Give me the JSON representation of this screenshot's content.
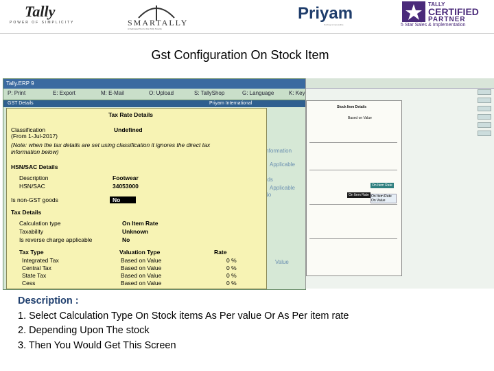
{
  "logos": {
    "tally": {
      "word": "Tally",
      "tagline": "POWER OF SIMPLICITY"
    },
    "smartally": {
      "word": "SMARTALLY",
      "tagline": "A Dedicated Tool to Run Tally Smartly"
    },
    "priyam": {
      "word": "Priyam",
      "tagline": "Nothing is Impossible"
    },
    "certified": {
      "line1": "TALLY",
      "line2": "CERTIFIED",
      "line3": "PARTNER",
      "line4": "5 Star Sales & Implementation"
    }
  },
  "slide_title": "Gst  Configuration On Stock Item",
  "tally_window": {
    "title": "Tally.ERP 9",
    "menu": [
      "P: Print",
      "E: Export",
      "M: E-Mail",
      "O: Upload",
      "S: TallyShop",
      "G: Language",
      "K: Keyboard"
    ],
    "header_left": "GST Details",
    "header_right": "Priyam International"
  },
  "gst_form": {
    "section_title": "Tax Rate Details",
    "classification_label": "Classification",
    "classification_sub": "(From 1-Jul-2017)",
    "classification_value": "Undefined",
    "note": "(Note: when the tax details are set using classification it ignores the direct tax information below)",
    "hsn_section": "HSN/SAC Details",
    "description_label": "Description",
    "description_value": "Footwear",
    "hsn_label": "HSN/SAC",
    "hsn_value": "34053000",
    "non_gst_label": "Is non-GST goods",
    "non_gst_value": "No",
    "tax_details": "Tax Details",
    "calc_type_label": "Calculation type",
    "calc_type_value": "On Item Rate",
    "taxability_label": "Taxability",
    "taxability_value": "Unknown",
    "reverse_label": "Is reverse charge applicable",
    "reverse_value": "No",
    "col_tax_type": "Tax Type",
    "col_valuation": "Valuation Type",
    "col_rate": "Rate",
    "rows": [
      {
        "type": "Integrated Tax",
        "valuation": "Based on Value",
        "rate": "0 %"
      },
      {
        "type": "Central Tax",
        "valuation": "Based on Value",
        "rate": "0 %"
      },
      {
        "type": "State Tax",
        "valuation": "Based on Value",
        "rate": "0 %"
      },
      {
        "type": "Cess",
        "valuation": "Based on Value",
        "rate": "0 %"
      }
    ]
  },
  "background_labels": [
    "Information",
    "Applicable",
    "ods",
    "Applicable",
    "No",
    "Value"
  ],
  "side_window": {
    "popup_title": "Stock Item Details",
    "popup_value": "Based on Value",
    "list_items": [
      "On Item Rate",
      "On Value"
    ],
    "teal_label": "On Item Rate"
  },
  "description": {
    "heading": "Description :",
    "lines": [
      "1. Select Calculation Type On Stock items As Per value Or As Per item rate",
      "2. Depending Upon The stock",
      "3. Then You Would Get This Screen"
    ]
  }
}
